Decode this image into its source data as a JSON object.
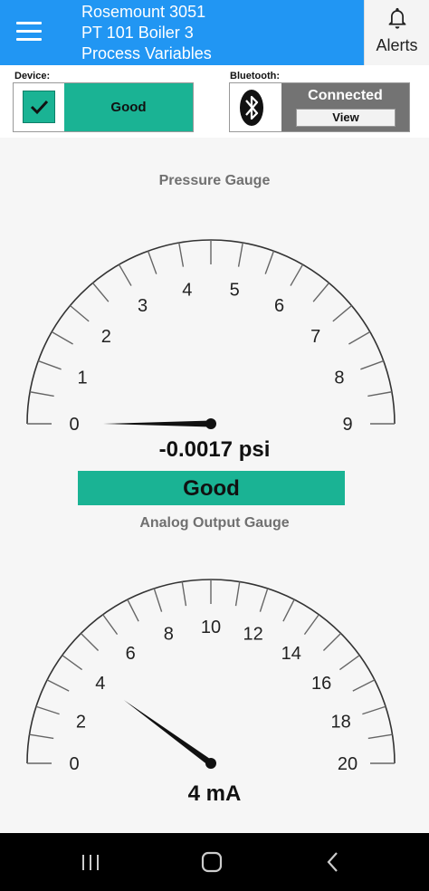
{
  "header": {
    "line1": "Rosemount 3051",
    "line2": "PT 101 Boiler 3",
    "line3": "Process Variables",
    "alerts_label": "Alerts",
    "menu_icon": "hamburger-menu-icon",
    "alerts_icon": "bell-icon"
  },
  "device": {
    "label": "Device:",
    "status": "Good",
    "icon": "checkmark-icon"
  },
  "bluetooth": {
    "label": "Bluetooth:",
    "status": "Connected",
    "view_label": "View",
    "icon": "bluetooth-icon"
  },
  "pressure_gauge": {
    "title": "Pressure Gauge",
    "tick_labels": [
      "0",
      "1",
      "2",
      "3",
      "4",
      "5",
      "6",
      "7",
      "8",
      "9"
    ],
    "min": 0,
    "max": 9,
    "value": -0.0017,
    "readout": "-0.0017 psi",
    "status": "Good"
  },
  "analog_gauge": {
    "title": "Analog Output Gauge",
    "tick_labels": [
      "0",
      "2",
      "4",
      "6",
      "8",
      "10",
      "12",
      "14",
      "16",
      "18",
      "20"
    ],
    "min": 0,
    "max": 20,
    "value": 4,
    "readout": "4 mA"
  },
  "colors": {
    "header": "#2196f3",
    "good": "#1ab394",
    "bt_panel": "#737373"
  },
  "navbar": {
    "icons": [
      "recent-apps-icon",
      "home-icon",
      "back-icon"
    ]
  }
}
